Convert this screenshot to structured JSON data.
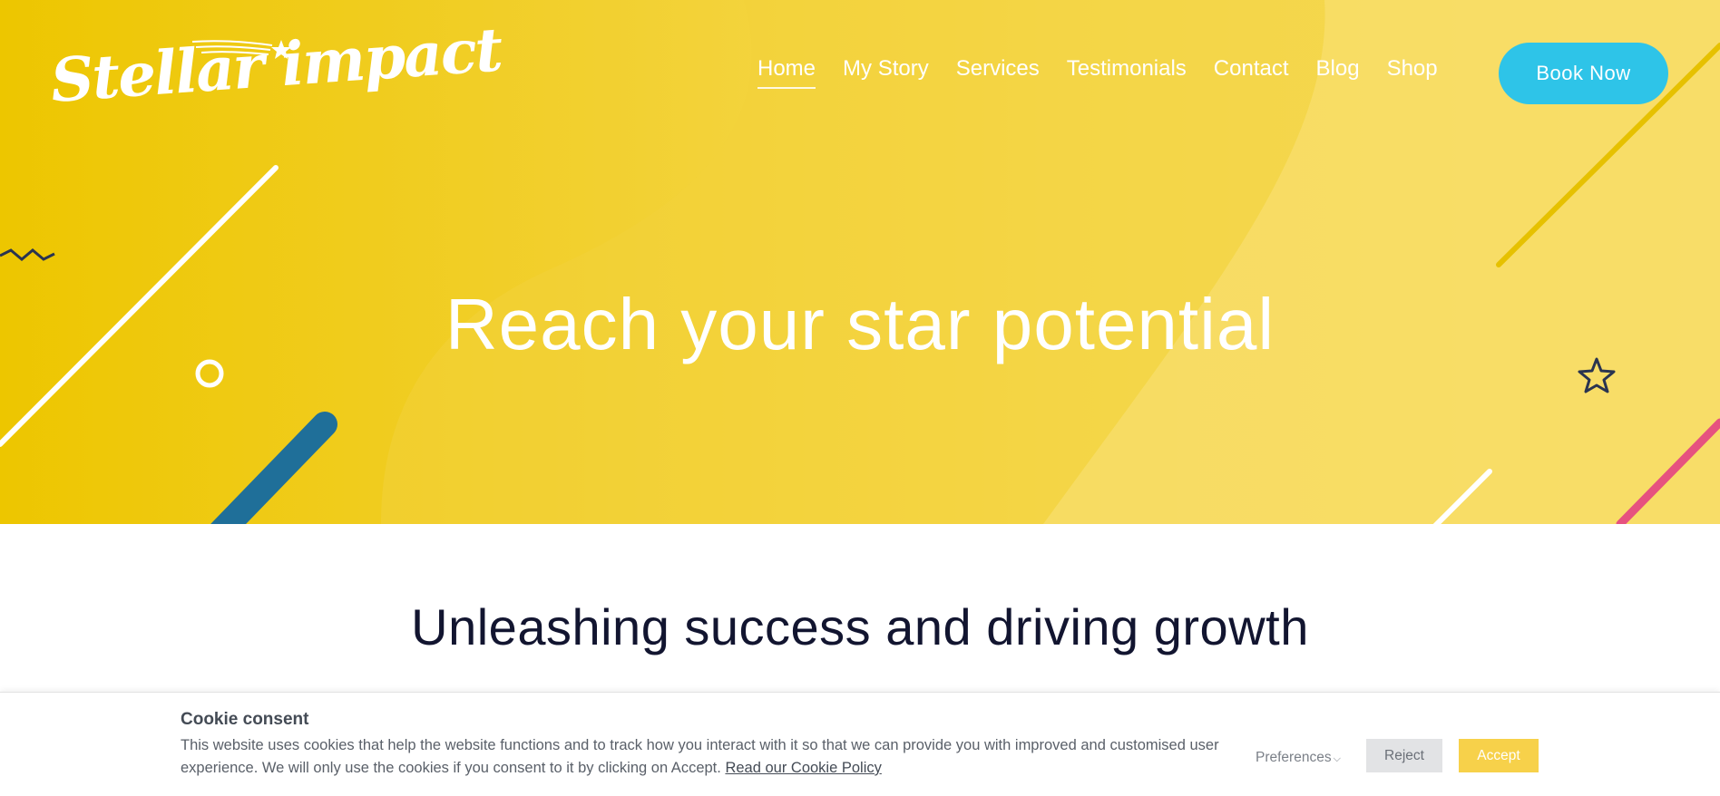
{
  "site": {
    "logo_text": "Stellar impact"
  },
  "nav": {
    "items": [
      {
        "label": "Home",
        "active": true
      },
      {
        "label": "My Story"
      },
      {
        "label": "Services"
      },
      {
        "label": "Testimonials"
      },
      {
        "label": "Contact"
      },
      {
        "label": "Blog"
      },
      {
        "label": "Shop"
      }
    ],
    "cta_label": "Book Now"
  },
  "hero": {
    "title": "Reach your star potential"
  },
  "intro": {
    "title": "Unleashing success and driving growth"
  },
  "cookie": {
    "title": "Cookie consent",
    "text": "This website uses cookies that help the website functions and to track how you interact with it so that we can provide you with improved and customised user experience. We will only use the cookies if you consent to it by clicking on Accept.",
    "link_text": "Read our Cookie Policy",
    "preferences_label": "Preferences",
    "reject_label": "Reject",
    "accept_label": "Accept"
  },
  "colors": {
    "hero_yellow": "#f2d030",
    "cta_blue": "#2ec4e8",
    "heading_navy": "#121530",
    "accept_yellow": "#f7d14a",
    "accent_pink": "#e6527f",
    "accent_teal": "#1f6f99"
  },
  "icons": [
    "shooting-star-icon",
    "star-outline-icon",
    "zigzag-icon",
    "ring-icon",
    "chevron-down-icon"
  ]
}
